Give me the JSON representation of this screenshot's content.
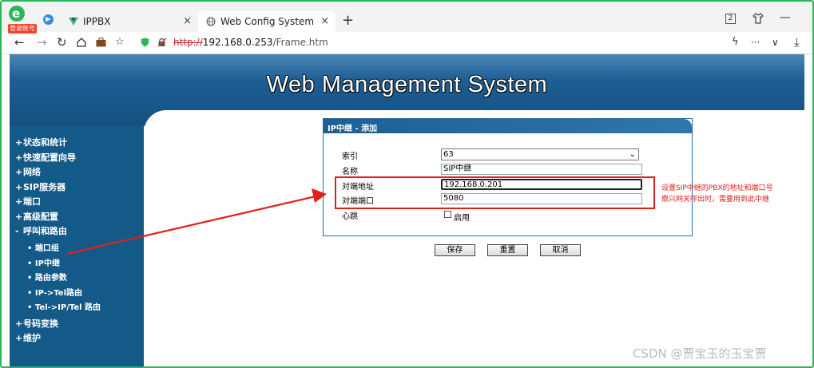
{
  "browser": {
    "logo_badge": "登录账号",
    "tabs": [
      {
        "label": "IPPBX",
        "close": "×"
      },
      {
        "label": "Web Config System",
        "close": "×"
      }
    ],
    "new_tab": "+",
    "window_count": "2",
    "minimize": "—",
    "url_proto": "http://",
    "url_host": "192.168.0.253",
    "url_path": "/Frame.htm",
    "nav_icons": [
      "back-icon",
      "forward-icon",
      "reload-icon",
      "home-icon",
      "briefcase-icon",
      "favorite-icon",
      "shield-icon",
      "insecure-icon"
    ],
    "right_icons": [
      "lightning-icon",
      "more-icon",
      "dropdown-icon",
      "download-icon"
    ],
    "more": "···",
    "dropdown": "∨"
  },
  "banner": {
    "title": "Web Management System"
  },
  "sidebar": {
    "items": [
      {
        "label": "状态和统计",
        "bullet": "+"
      },
      {
        "label": "快速配置向导",
        "bullet": "+"
      },
      {
        "label": "网络",
        "bullet": "+"
      },
      {
        "label": "SIP服务器",
        "bullet": "+"
      },
      {
        "label": "端口",
        "bullet": "+"
      },
      {
        "label": "高级配置",
        "bullet": "+"
      },
      {
        "label": "呼叫和路由",
        "bullet": "-"
      }
    ],
    "subitems": [
      {
        "label": "端口组"
      },
      {
        "label": "IP中继"
      },
      {
        "label": "路由参数"
      },
      {
        "label": "IP->Tel路由"
      },
      {
        "label": "Tel->IP/Tel 路由"
      }
    ],
    "bottom_items": [
      {
        "label": "号码变换",
        "bullet": "+"
      },
      {
        "label": "维护",
        "bullet": "+"
      }
    ],
    "sub_bullet": "•"
  },
  "panel": {
    "title": "IP中继 - 添加",
    "fields": {
      "index_label": "索引",
      "index_value": "63",
      "name_label": "名称",
      "name_value": "SIP中继",
      "peer_addr_label": "对端地址",
      "peer_addr_value": "192.168.0.201",
      "peer_port_label": "对端端口",
      "peer_port_value": "5080",
      "heartbeat_label": "心跳",
      "heartbeat_enable": "启用"
    }
  },
  "buttons": {
    "save": "保存",
    "reset": "重置",
    "cancel": "取消"
  },
  "annotation": {
    "line1": "设置SIP中继的PBX的地址和端口号",
    "line2": "鼎兴网关呼出时，需要用到此中继"
  },
  "watermark": "CSDN @贾宝玉的玉宝贾",
  "colors": {
    "banner": "#1f5e94",
    "sidebar": "#135a89",
    "annotation": "#e0201b",
    "frame": "#2fb45a"
  }
}
